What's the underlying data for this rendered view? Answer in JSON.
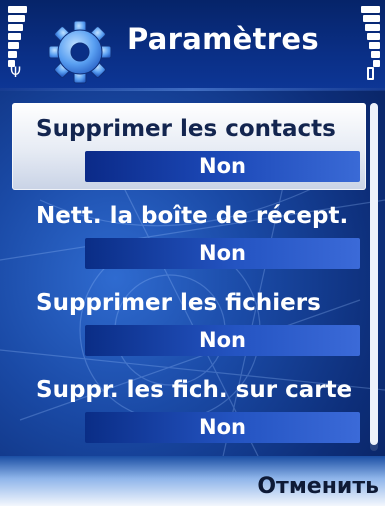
{
  "header": {
    "title": "Paramètres",
    "app_icon": "gear-settings-icon",
    "signal_icon": "antenna-icon",
    "battery_icon": "battery-icon",
    "signal_bars": 7,
    "battery_bars": 7
  },
  "settings": [
    {
      "label": "Supprimer les contacts",
      "value": "Non",
      "selected": true
    },
    {
      "label": "Nett. la boîte de récept.",
      "value": "Non",
      "selected": false
    },
    {
      "label": "Supprimer les fichiers",
      "value": "Non",
      "selected": false
    },
    {
      "label": "Suppr. les fich. sur carte",
      "value": "Non",
      "selected": false
    }
  ],
  "softkeys": {
    "right": "Отменить"
  },
  "colors": {
    "background": "#1a4aa6",
    "selection": "#e6ebf4",
    "value_bar": "#1c49b8"
  }
}
